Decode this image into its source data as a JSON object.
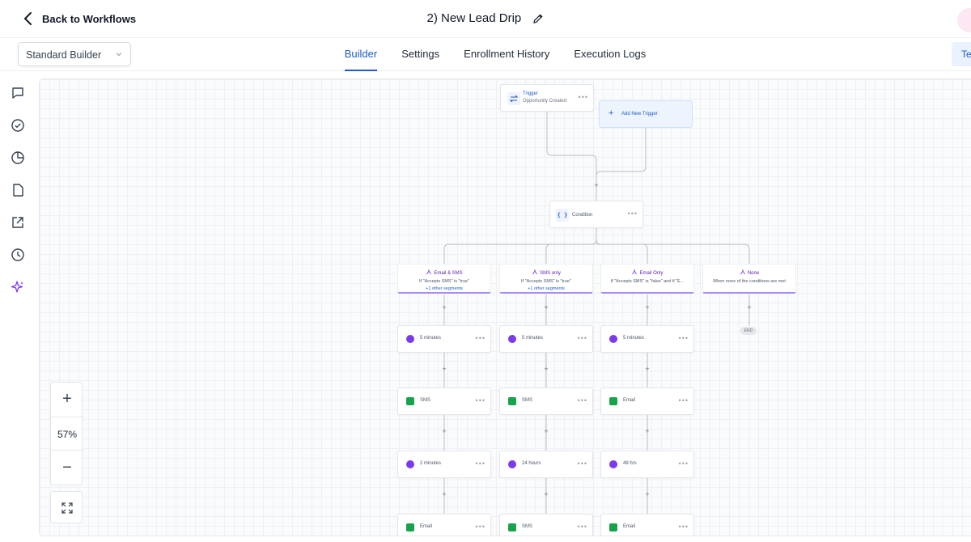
{
  "header": {
    "back_label": "Back to Workflows",
    "workflow_title": "2) New Lead Drip"
  },
  "subbar": {
    "builder_mode": "Standard Builder",
    "tabs": [
      {
        "label": "Builder",
        "active": true
      },
      {
        "label": "Settings",
        "active": false
      },
      {
        "label": "Enrollment History",
        "active": false
      },
      {
        "label": "Execution Logs",
        "active": false
      }
    ],
    "test_button_label": "Te"
  },
  "rail_icons": [
    "chat-icon",
    "check-circle-icon",
    "pie-chart-icon",
    "file-icon",
    "external-link-icon",
    "history-icon",
    "sparkles-icon"
  ],
  "canvas": {
    "trigger": {
      "title": "Trigger",
      "subtitle": "Opportunity Created"
    },
    "add_trigger_label": "Add New Trigger",
    "condition_label": "Condition",
    "branches": [
      {
        "name": "Email & SMS",
        "desc": "If \"Accepts SMS\" is \"true\"",
        "extra": "+1 other segments"
      },
      {
        "name": "SMS only",
        "desc": "If \"Accepts SMS\" is \"true\"",
        "extra": "+1 other segments"
      },
      {
        "name": "Email Only",
        "desc": "If \"Accepts SMS\" is \"false\" and if \"E...",
        "extra": ""
      },
      {
        "name": "None",
        "desc": "When none of the conditions are met",
        "extra": ""
      }
    ],
    "end_label": "END",
    "steps": {
      "col1": [
        "5 minutes",
        "SMS",
        "2 minutes",
        "Email"
      ],
      "col2": [
        "5 minutes",
        "SMS",
        "24 hours",
        "SMS"
      ],
      "col3": [
        "5 minutes",
        "Email",
        "48 hrs",
        "Email"
      ]
    }
  },
  "zoom": {
    "level": "57%",
    "plus": "+",
    "minus": "−"
  },
  "colors": {
    "accent": "#1e5bc7",
    "branch": "#a78bfa",
    "wait": "#7c3aed",
    "action": "#16a34a"
  }
}
